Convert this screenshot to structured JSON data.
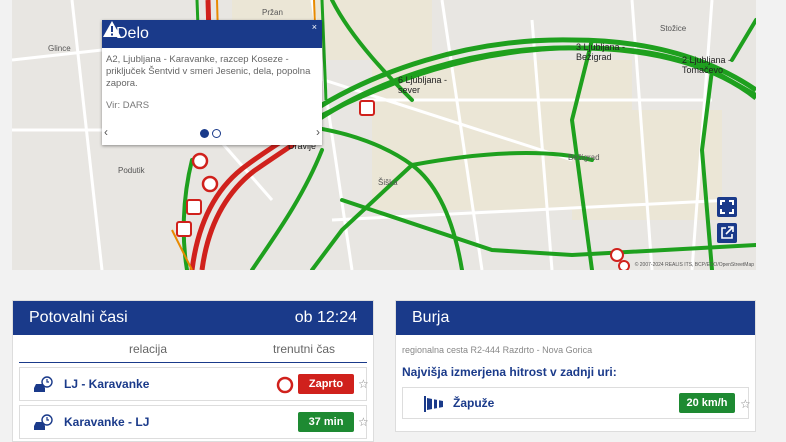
{
  "map": {
    "place_labels": [
      "Pržan",
      "Glince",
      "Podutik",
      "Šiška",
      "Bežigrad",
      "Stožice"
    ],
    "road_labels": [
      "3 Ljubljana -\nBežigrad",
      "2 Ljubljana -\nTomačevo",
      "6 Ljubljana -\nsever",
      "Dravlje"
    ],
    "attribution": "© 2007-2024 REALIS ITS, BCP/ECO/OpenStreetMap",
    "colors": {
      "free": "#1ea01e",
      "slow": "#e88a00",
      "jam": "#d0211c"
    }
  },
  "popup": {
    "title": "Delo",
    "close": "×",
    "text": "A2, Ljubljana - Karavanke, razcep Koseze - priključek Šentvid v smeri Jesenic, dela, popolna zapora.",
    "source": "Vir: DARS",
    "prev": "‹",
    "next": "›"
  },
  "travel_times": {
    "title": "Potovalni časi",
    "time": "ob 12:24",
    "col_relation": "relacija",
    "col_current": "trenutni čas",
    "rows": [
      {
        "label": "LJ - Karavanke",
        "status": "Zaprto",
        "status_color": "#d0211c",
        "closed": true
      },
      {
        "label": "Karavanke - LJ",
        "status": "37 min",
        "status_color": "#1e8a32",
        "closed": false
      }
    ]
  },
  "burja": {
    "title": "Burja",
    "road": "regionalna cesta R2-444 Razdrto - Nova Gorica",
    "heading": "Najvišja izmerjena hitrost v zadnji uri:",
    "location": "Žapuže",
    "speed": "20 km/h",
    "speed_color": "#1e8a32"
  }
}
